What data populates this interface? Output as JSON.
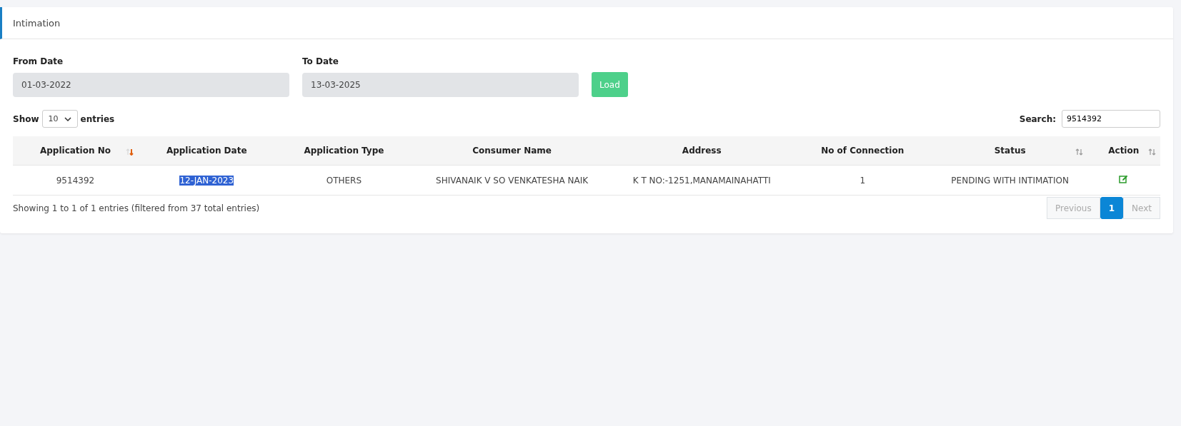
{
  "card": {
    "title": "Intimation"
  },
  "filters": [
    {
      "label": "From Date",
      "value": "01-03-2022"
    },
    {
      "label": "To Date",
      "value": "13-03-2025"
    }
  ],
  "load_button": "Load",
  "length": {
    "prefix": "Show",
    "value": "10",
    "suffix": "entries"
  },
  "search": {
    "label": "Search:",
    "value": "9514392"
  },
  "table": {
    "columns": [
      {
        "label": "Application No",
        "sortable": true,
        "sorted_desc": true
      },
      {
        "label": "Application Date",
        "sortable": false,
        "sorted_desc": false
      },
      {
        "label": "Application Type",
        "sortable": false,
        "sorted_desc": false
      },
      {
        "label": "Consumer Name",
        "sortable": false,
        "sorted_desc": false
      },
      {
        "label": "Address",
        "sortable": false,
        "sorted_desc": false
      },
      {
        "label": "No of Connection",
        "sortable": false,
        "sorted_desc": false
      },
      {
        "label": "Status",
        "sortable": true,
        "sorted_desc": false
      },
      {
        "label": "Action",
        "sortable": true,
        "sorted_desc": false
      }
    ],
    "rows": [
      {
        "cells": [
          {
            "text": "9514392",
            "highlighted": false
          },
          {
            "text": "12-JAN-2023",
            "highlighted": true
          },
          {
            "text": "OTHERS",
            "highlighted": false
          },
          {
            "text": "SHIVANAIK V SO VENKATESHA NAIK",
            "highlighted": false
          },
          {
            "text": "K T NO:-1251,MANAMAINAHATTI",
            "highlighted": false
          },
          {
            "text": "1",
            "highlighted": false
          },
          {
            "text": "PENDING WITH INTIMATION",
            "highlighted": false
          }
        ],
        "action": {
          "kind": "edit"
        }
      }
    ]
  },
  "info": "Showing 1 to 1 of 1 entries (filtered from 37 total entries)",
  "pagination": [
    {
      "label": "Previous",
      "selected": false,
      "disabled": true
    },
    {
      "label": "1",
      "selected": true,
      "disabled": false
    },
    {
      "label": "Next",
      "selected": false,
      "disabled": true
    }
  ]
}
